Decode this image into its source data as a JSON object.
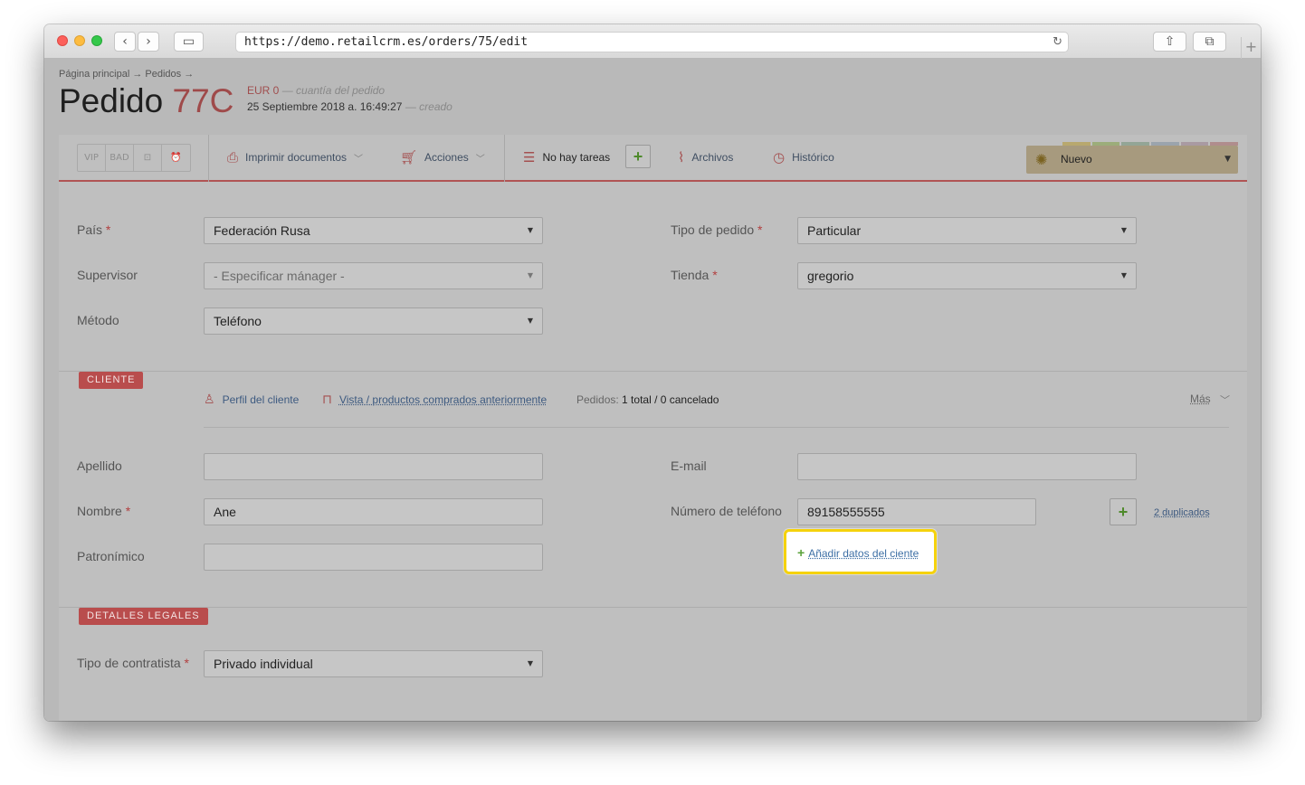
{
  "browser": {
    "url": "https://demo.retailcrm.es/orders/75/edit",
    "back_glyph": "‹",
    "forward_glyph": "›",
    "sidebar_glyph": "▭",
    "reload_glyph": "↻",
    "share_glyph": "⇧",
    "tabs_glyph": "⧉",
    "newtab_glyph": "+"
  },
  "header": {
    "breadcrumb": "Página principal → Pedidos →",
    "title_prefix": "Pedido",
    "order_number": "77C",
    "sum_value": "EUR 0",
    "sum_label": "— cuantía del pedido",
    "created_date": "25 Septiembre 2018 a. 16:49:27",
    "created_label": "— creado"
  },
  "toolbar": {
    "tags": [
      "VIP",
      "BAD",
      "⊡",
      "⏰"
    ],
    "print_label": "Imprimir documentos",
    "actions_label": "Acciones",
    "tasks_label": "No hay tareas",
    "files_label": "Archivos",
    "history_label": "Histórico",
    "status_label": "Nuevo",
    "status_stripe_colors": [
      "#b8a86e",
      "#9cad7a",
      "#93a596",
      "#9ba4ad",
      "#a99aa2",
      "#b08d8d"
    ]
  },
  "form": {
    "pais_label": "País",
    "pais_value": "Federación Rusa",
    "tipo_pedido_label": "Tipo de pedido",
    "tipo_pedido_value": "Particular",
    "supervisor_label": "Supervisor",
    "supervisor_value": "- Especificar mánager -",
    "tienda_label": "Tienda",
    "tienda_value": "gregorio",
    "metodo_label": "Método",
    "metodo_value": "Teléfono"
  },
  "cliente": {
    "section_label": "CLIENTE",
    "profile_link": "Perfil del cliente",
    "history_link": "Vista / productos comprados anteriormente",
    "orders_label": "Pedidos:",
    "orders_value": "1 total / 0 cancelado",
    "more_label": "Más",
    "apellido_label": "Apellido",
    "apellido_value": "",
    "email_label": "E-mail",
    "email_value": "",
    "nombre_label": "Nombre",
    "nombre_value": "Ane",
    "telefono_label": "Número de teléfono",
    "telefono_value": "89158555555",
    "duplicates_link": "2 duplicados",
    "patronimico_label": "Patronímico",
    "patronimico_value": "",
    "add_client_data": "Añadir datos del ciente"
  },
  "legal": {
    "section_label": "DETALLES LEGALES",
    "contratista_label": "Tipo de contratista",
    "contratista_value": "Privado individual"
  }
}
